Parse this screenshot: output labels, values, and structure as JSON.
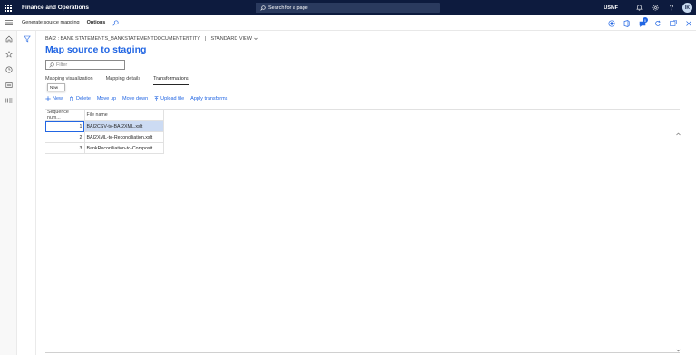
{
  "header": {
    "app_title": "Finance and Operations",
    "search_placeholder": "Search for a page",
    "company": "USMF",
    "user_initials": "IK",
    "colors": {
      "bar": "#0d1b3e",
      "accent": "#2266e3"
    }
  },
  "action_strip": {
    "item1": "Generate source mapping",
    "item2": "Options",
    "badge_count": "0"
  },
  "main": {
    "breadcrumb_entity": "BAI2 : BANK STATEMENTS_BANKSTATEMENTDOCUMENTENTITY",
    "breadcrumb_sep": "|",
    "breadcrumb_view": "STANDARD VIEW",
    "page_title": "Map source to staging",
    "filter_placeholder": "Filter",
    "tabs": [
      "Mapping visualization",
      "Mapping details",
      "Transformations"
    ],
    "active_tab": "Transformations",
    "tooltip": "New",
    "toolbar": {
      "new": "New",
      "delete": "Delete",
      "move_up": "Move up",
      "move_down": "Move down",
      "upload_file": "Upload file",
      "apply_transforms": "Apply transforms"
    },
    "grid": {
      "columns": [
        "Sequence num...",
        "File name"
      ],
      "rows": [
        {
          "seq": "1",
          "file": "BAI2CSV-to-BAI2XML.xslt",
          "selected": true
        },
        {
          "seq": "2",
          "file": "BAI2XML-to-Reconciliation.xslt",
          "selected": false
        },
        {
          "seq": "3",
          "file": "BankReconiliation-to-Composit...",
          "selected": false
        }
      ]
    }
  }
}
